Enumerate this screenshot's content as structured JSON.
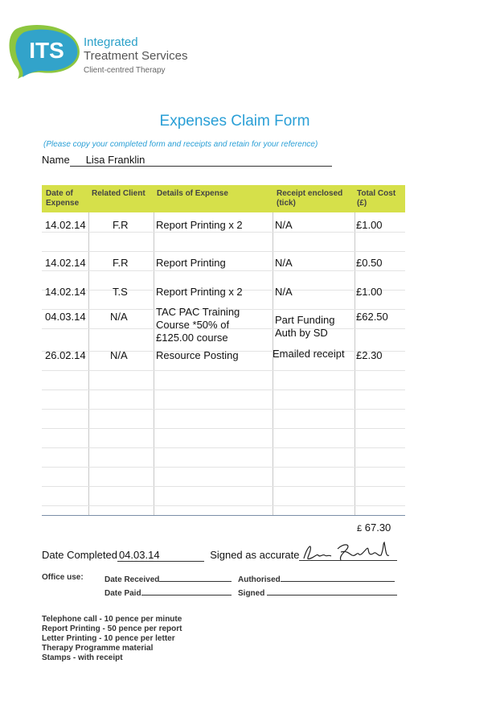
{
  "logo": {
    "badge": "ITS",
    "line1": "Integrated",
    "line2": "Treatment Services",
    "tagline": "Client-centred Therapy"
  },
  "form": {
    "title": "Expenses Claim Form",
    "note": "(Please copy your completed form and receipts and retain for your reference)",
    "name_label": "Name",
    "name_value": "Lisa Franklin"
  },
  "table": {
    "headers": {
      "date_l1": "Date of",
      "date_l2": "Expense",
      "client": "Related Client",
      "details": "Details of Expense",
      "receipt_l1": "Receipt enclosed",
      "receipt_l2": "(tick)",
      "total_l1": "Total Cost",
      "total_l2": "(£)"
    },
    "rows": [
      {
        "date": "14.02.14",
        "client": "F.R",
        "details": "Report Printing x 2",
        "receipt": "N/A",
        "cost": "£1.00"
      },
      {
        "date": "14.02.14",
        "client": "F.R",
        "details": "Report Printing",
        "receipt": "N/A",
        "cost": "£0.50"
      },
      {
        "date": "14.02.14",
        "client": "T.S",
        "details": "Report Printing x 2",
        "receipt": "N/A",
        "cost": "£1.00"
      },
      {
        "date": "04.03.14",
        "client": "N/A",
        "details_l1": "TAC PAC Training",
        "details_l2": "Course *50% of",
        "details_l3": "£125.00 course",
        "receipt_l1": "Part Funding",
        "receipt_l2": "Auth by SD",
        "cost": "£62.50"
      },
      {
        "date": "26.02.14",
        "client": "N/A",
        "details": "Resource Posting",
        "receipt": "Emailed receipt",
        "cost": "£2.30"
      }
    ]
  },
  "total": {
    "currency": "£",
    "amount": "67.30"
  },
  "completion": {
    "date_label": "Date Completed",
    "date_value": "04.03.14",
    "signed_label": "Signed as accurate"
  },
  "office": {
    "label": "Office use:",
    "date_received": "Date Received",
    "authorised": "Authorised",
    "date_paid": "Date Paid",
    "signed": "Signed"
  },
  "rates": [
    "Telephone call - 10 pence per minute",
    "Report Printing - 50 pence per report",
    "Letter Printing - 10 pence per letter",
    "Therapy Programme material",
    "Stamps - with receipt"
  ],
  "colors": {
    "accent_blue": "#2a9fd6",
    "header_green": "#d6e04a",
    "logo_green": "#8dc63f"
  }
}
